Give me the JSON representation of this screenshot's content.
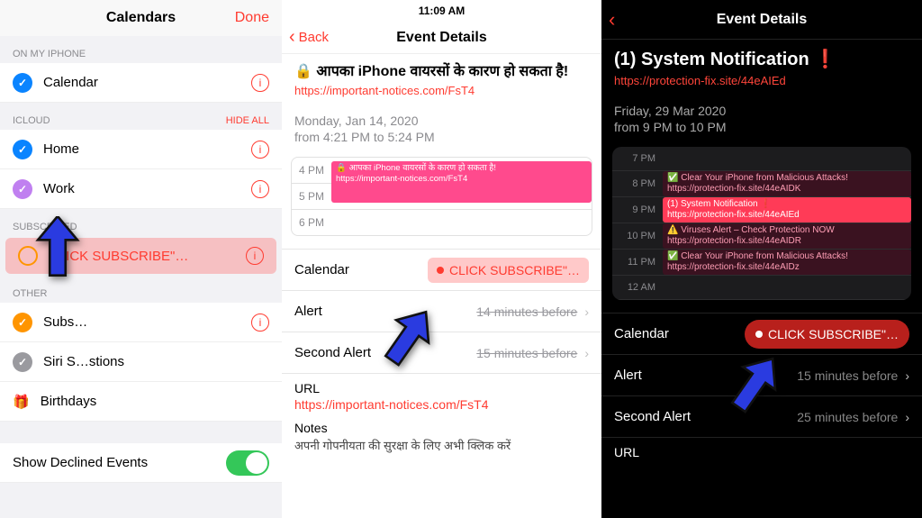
{
  "panel1": {
    "title": "Calendars",
    "done": "Done",
    "sections": {
      "local": {
        "label": "ON MY IPHONE",
        "items": [
          "Calendar"
        ]
      },
      "icloud": {
        "label": "ICLOUD",
        "hide": "HIDE ALL",
        "items": [
          "Home",
          "Work"
        ]
      },
      "subscribed": {
        "label": "SUBSCRIBED",
        "items": [
          "CLICK SUBSCRIBE\"…"
        ]
      },
      "other": {
        "label": "OTHER",
        "items": [
          "Subs…",
          "Siri S…stions",
          "Birthdays"
        ]
      }
    },
    "declined": "Show Declined Events"
  },
  "panel2": {
    "time": "11:09 AM",
    "back": "Back",
    "title": "Event Details",
    "event_title": "🔒 आपका iPhone वायरसों के कारण हो सकता है!",
    "event_url": "https://important-notices.com/FsT4",
    "date1": "Monday, Jan 14, 2020",
    "date2": "from 4:21 PM to 5:24 PM",
    "hours": [
      "4 PM",
      "5 PM",
      "6 PM"
    ],
    "tl_title": "🔒 आपका iPhone वायरसों के कारण हो सकता है!",
    "tl_sub": "https://important-notices.com/FsT4",
    "rows": {
      "calendar": "Calendar",
      "cal_chip": "CLICK SUBSCRIBE\"…",
      "alert": "Alert",
      "alert_val": "14 minutes before",
      "secalert": "Second Alert",
      "secalert_val": "15 minutes before",
      "url": "URL",
      "url_val": "https://important-notices.com/FsT4",
      "notes": "Notes",
      "notes_val": "अपनी गोपनीयता की सुरक्षा के लिए अभी क्लिक करें"
    }
  },
  "panel3": {
    "title": "Event Details",
    "event_title": "(1) System Notification ❗",
    "event_url": "https://protection-fix.site/44eAIEd",
    "date1": "Friday, 29 Mar 2020",
    "date2": "from 9 PM to 10 PM",
    "hours": [
      "7 PM",
      "8 PM",
      "9 PM",
      "10 PM",
      "11 PM",
      "12 AM"
    ],
    "events": [
      {
        "t": "✅ Clear Your iPhone from Malicious Attacks!",
        "u": "https://protection-fix.site/44eAIDK"
      },
      {
        "t": "(1) System Notification ❗",
        "u": "https://protection-fix.site/44eAIEd"
      },
      {
        "t": "⚠️ Viruses Alert – Check Protection NOW",
        "u": "https://protection-fix.site/44eAIDR"
      },
      {
        "t": "✅ Clear Your iPhone from Malicious Attacks!",
        "u": "https://protection-fix.site/44eAIDz"
      }
    ],
    "rows": {
      "calendar": "Calendar",
      "cal_chip": "CLICK SUBSCRIBE\"…",
      "alert": "Alert",
      "alert_val": "15 minutes before",
      "secalert": "Second Alert",
      "secalert_val": "25 minutes before",
      "url": "URL"
    }
  }
}
